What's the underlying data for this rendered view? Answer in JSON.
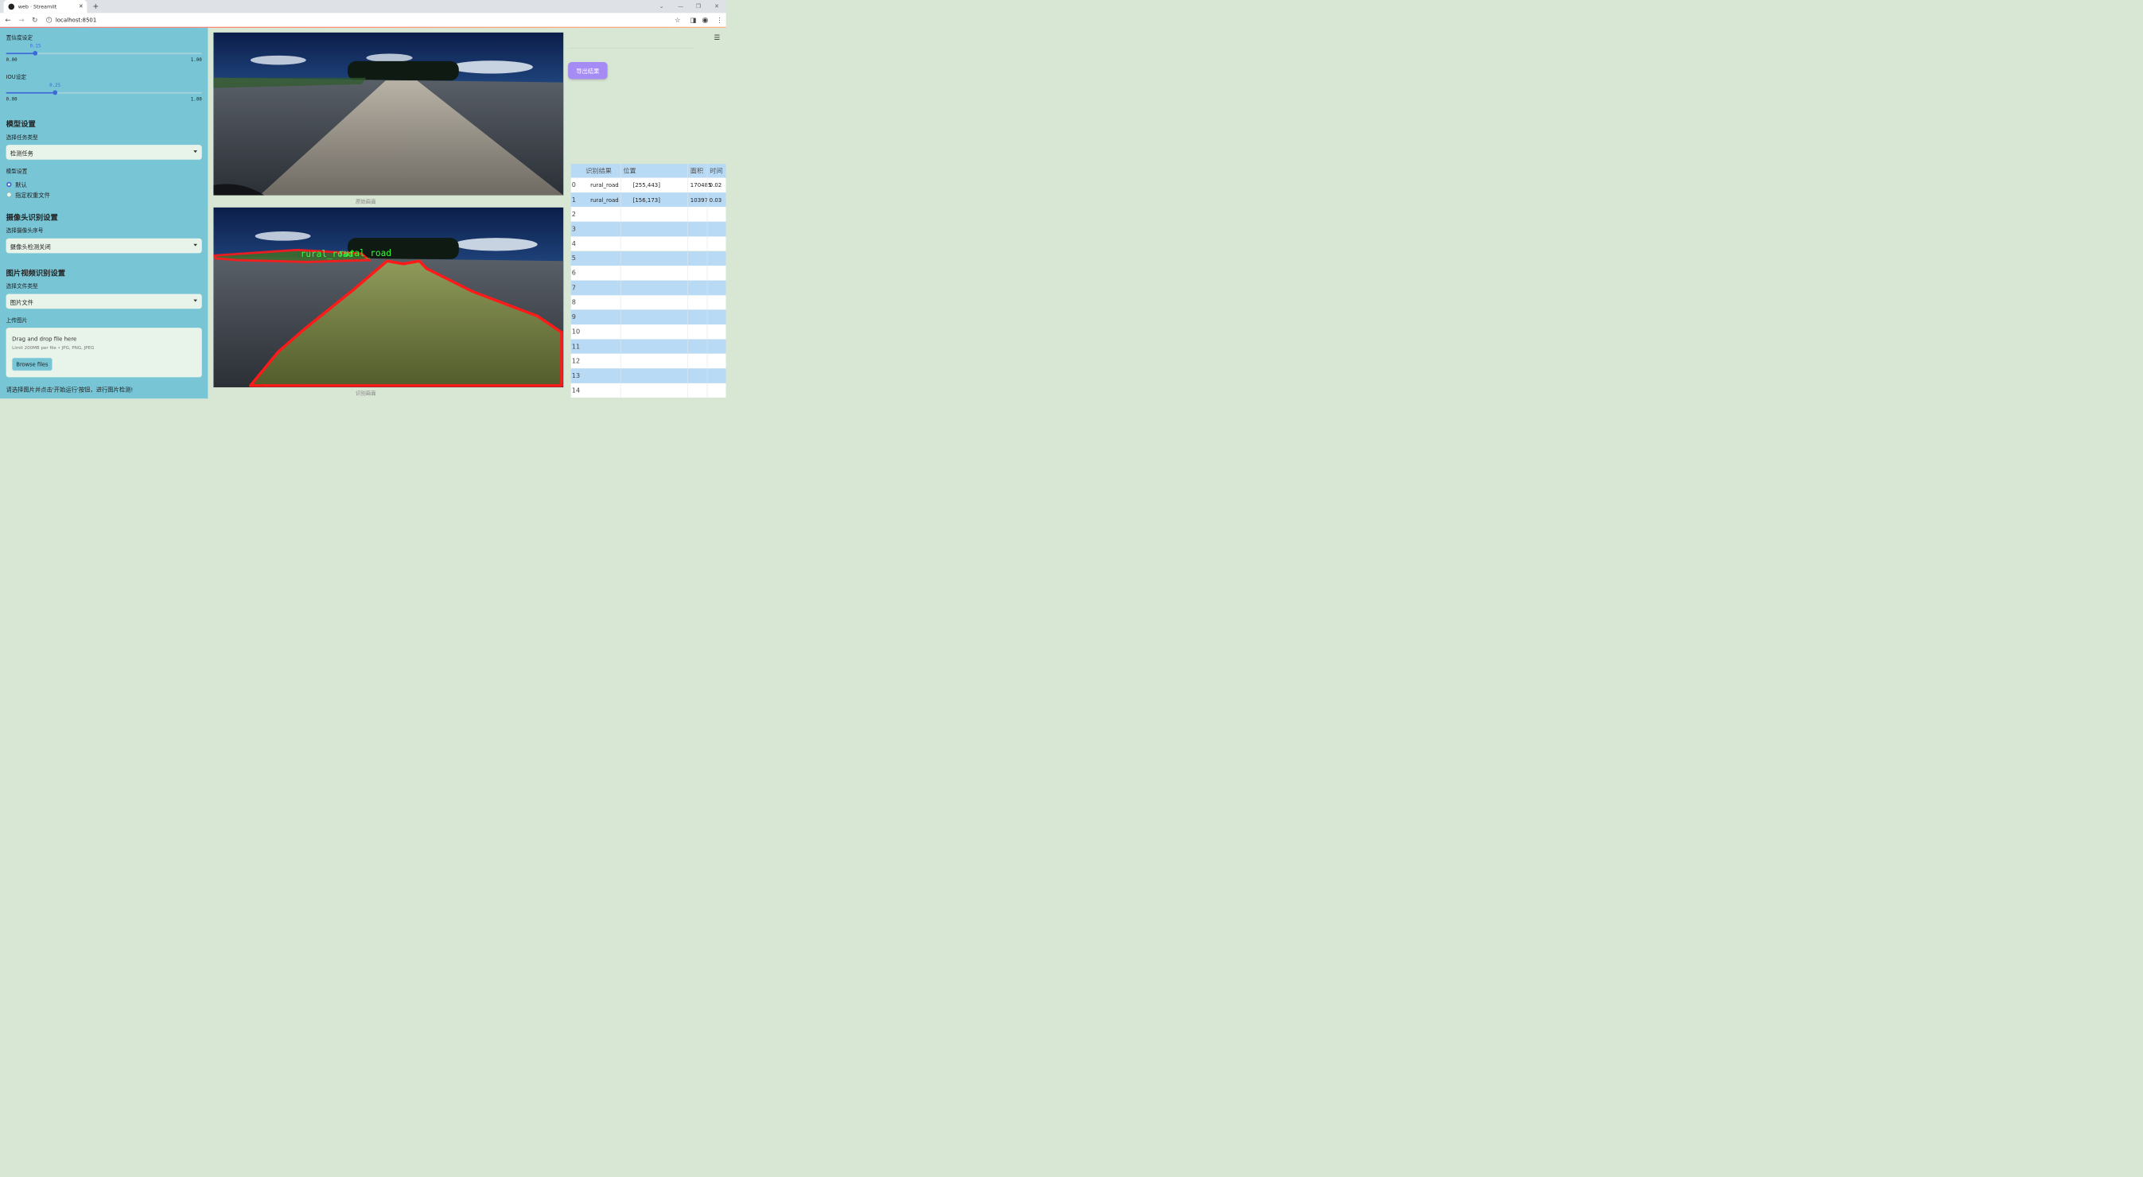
{
  "browser": {
    "tab_title": "web · Streamlit",
    "url": "localhost:8501"
  },
  "sidebar": {
    "confidence": {
      "label": "置信度设定",
      "value": "0.15",
      "value_num": 0.15,
      "min": "0.00",
      "max": "1.00"
    },
    "iou": {
      "label": "IOU设定",
      "value": "0.25",
      "value_num": 0.25,
      "min": "0.00",
      "max": "1.00"
    },
    "model_settings_heading": "模型设置",
    "task_type_label": "选择任务类型",
    "task_type_value": "检测任务",
    "model_label": "模型设置",
    "model_options": [
      "默认",
      "指定权重文件"
    ],
    "model_selected": "默认",
    "camera_heading": "摄像头识别设置",
    "camera_label": "选择摄像头序号",
    "camera_value": "摄像头检测关闭",
    "media_heading": "图片视频识别设置",
    "file_type_label": "选择文件类型",
    "file_type_value": "图片文件",
    "upload_label": "上传图片",
    "upload_drag": "Drag and drop file here",
    "upload_limit": "Limit 200MB per file • JPG, PNG, JPEG",
    "browse_button": "Browse files",
    "note": "请选择图片并点击'开始运行'按钮，进行图片检测!"
  },
  "main": {
    "original_caption": "原始画面",
    "result_caption": "识别画面",
    "detections": [
      {
        "label": "rural_road"
      },
      {
        "label": "rural_road"
      }
    ]
  },
  "right": {
    "export_button": "导出结果",
    "table": {
      "columns": [
        "识别结果",
        "位置",
        "面积",
        "时间"
      ],
      "rows": [
        [
          "0",
          "rural_road",
          "[255,443]",
          "170485",
          "0.02"
        ],
        [
          "1",
          "rural_road",
          "[156,173]",
          "10397",
          "0.03"
        ],
        [
          "2",
          "",
          "",
          "",
          ""
        ],
        [
          "3",
          "",
          "",
          "",
          ""
        ],
        [
          "4",
          "",
          "",
          "",
          ""
        ],
        [
          "5",
          "",
          "",
          "",
          ""
        ],
        [
          "6",
          "",
          "",
          "",
          ""
        ],
        [
          "7",
          "",
          "",
          "",
          ""
        ],
        [
          "8",
          "",
          "",
          "",
          ""
        ],
        [
          "9",
          "",
          "",
          "",
          ""
        ],
        [
          "10",
          "",
          "",
          "",
          ""
        ],
        [
          "11",
          "",
          "",
          "",
          ""
        ],
        [
          "12",
          "",
          "",
          "",
          ""
        ],
        [
          "13",
          "",
          "",
          "",
          ""
        ],
        [
          "14",
          "",
          "",
          "",
          ""
        ]
      ]
    }
  },
  "colors": {
    "sidebar_bg": "#78c5d6",
    "accent": "#3d6bd6",
    "export_button": "#a58cf5",
    "mask_outline": "#ff1a1a",
    "label_text": "#33ff33"
  }
}
